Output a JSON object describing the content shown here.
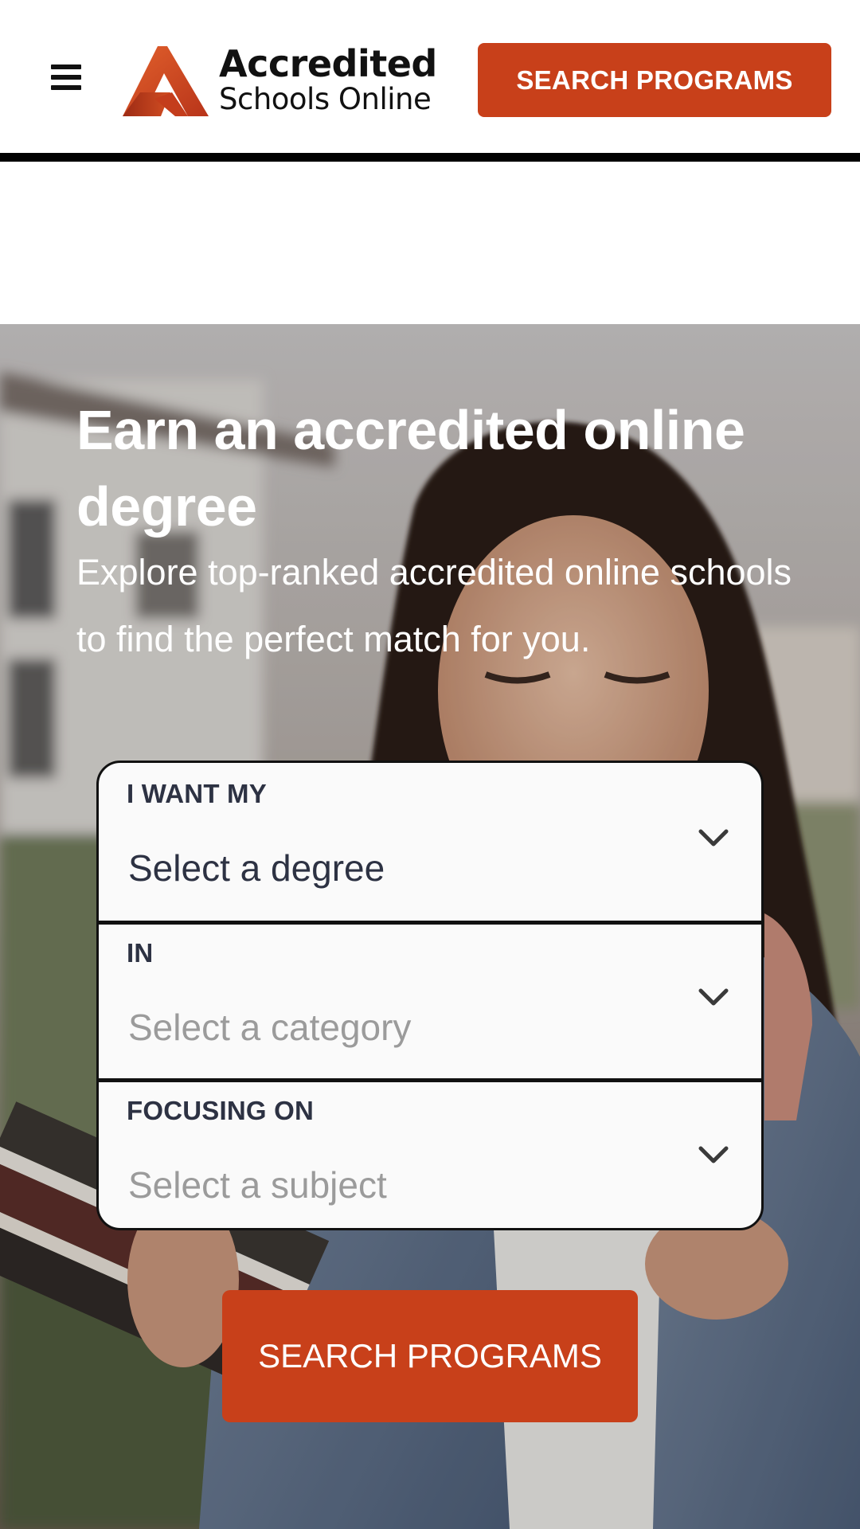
{
  "header": {
    "logo": {
      "line1": "Accredited",
      "line2": "Schools Online"
    },
    "menu_icon": "hamburger-menu-icon",
    "cta_label": "SEARCH PROGRAMS"
  },
  "hero": {
    "title": "Earn an accredited online degree",
    "subtitle": "Explore top-ranked accredited online schools to find the perfect match for you.",
    "form": {
      "degree": {
        "label": "I WANT MY",
        "value": "Select a degree",
        "icon": "chevron-down-icon"
      },
      "category": {
        "label": "IN",
        "value": "Select a category",
        "icon": "chevron-down-icon"
      },
      "subject": {
        "label": "FOCUSING ON",
        "value": "Select a subject",
        "icon": "chevron-down-icon"
      }
    },
    "search_button_label": "SEARCH PROGRAMS"
  },
  "colors": {
    "brand_orange": "#c8401a",
    "text_dark": "#2d3243",
    "placeholder_grey": "#9b9b9b"
  }
}
